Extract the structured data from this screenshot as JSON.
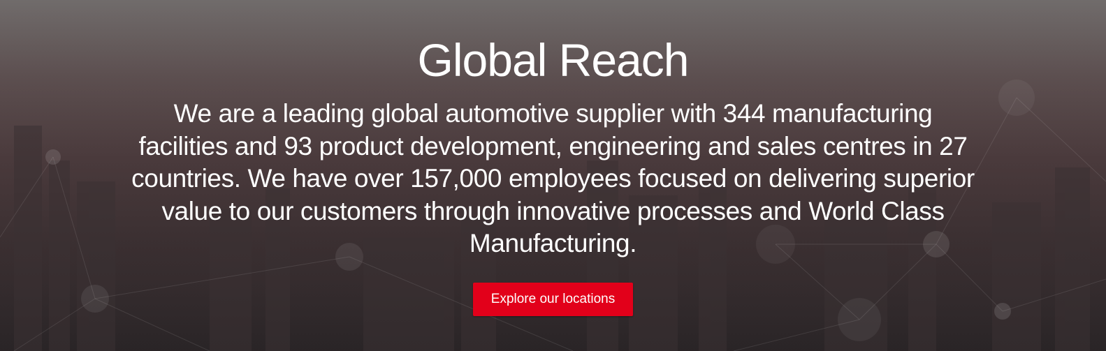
{
  "hero": {
    "title": "Global Reach",
    "description": "We are a leading global automotive supplier with 344 manufacturing facilities and 93 product development, engineering and sales centres in 27 countries. We have over 157,000 employees focused on delivering superior value to our customers through innovative processes and World Class Manufacturing.",
    "cta_label": "Explore our locations"
  },
  "colors": {
    "accent": "#e2001a",
    "text": "#ffffff"
  }
}
